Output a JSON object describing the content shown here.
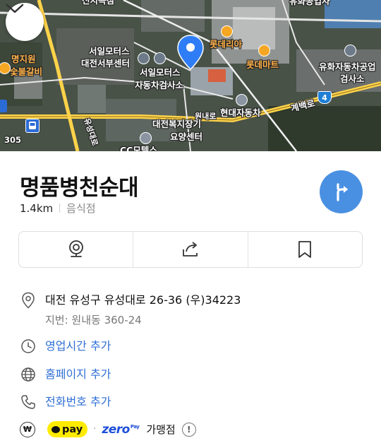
{
  "map": {
    "labels": {
      "top_partial": "신지독점",
      "right_top": "유화공업사",
      "seoil_motors_west": "서일모터스",
      "daejeon_west_center": "대전서부센터",
      "seoil_motors_east": "서일모터스",
      "car_inspection": "자동차검사소",
      "lotteria": "롯데리아",
      "lotte_mart": "롯데마트",
      "myeongjigwon": "명지원",
      "sutbulgalbi": "숯불갈비",
      "yuhwa_car": "유화자동차공업",
      "inspection_right": "검사소",
      "gyebaek_road": "계백로",
      "wonnae_road": "원내로",
      "hyundai_car": "현대자동차",
      "welfare_center_1": "대전복지장기",
      "welfare_center_2": "요양센터",
      "bottom_partial": "CC모텔스",
      "road_vertical": "유성대로",
      "road_num": "305",
      "shield_num": "4"
    }
  },
  "place": {
    "name": "명품병천순대",
    "distance": "1.4km",
    "category": "음식점"
  },
  "actions": {
    "street_view": "street-view-icon",
    "share": "share-icon",
    "bookmark": "bookmark-icon"
  },
  "info": {
    "address": "대전 유성구 유성대로 26-36 (우)34223",
    "jibun": "지번: 원내동 360-24",
    "hours_link": "영업시간 추가",
    "homepage_link": "홈페이지 추가",
    "phone_link": "전화번호 추가"
  },
  "payment": {
    "won_symbol": "₩",
    "kakaopay": "pay",
    "dot": "·",
    "zeropay": "zero",
    "zeropay_sup": "Pay",
    "affiliate": "가맹점",
    "info_icon": "!"
  },
  "colors": {
    "accent": "#4a90e2",
    "link": "#2f6fd6",
    "kakao_yellow": "#ffeb00",
    "pin": "#2f7df6",
    "poi_orange": "#f5a623"
  }
}
